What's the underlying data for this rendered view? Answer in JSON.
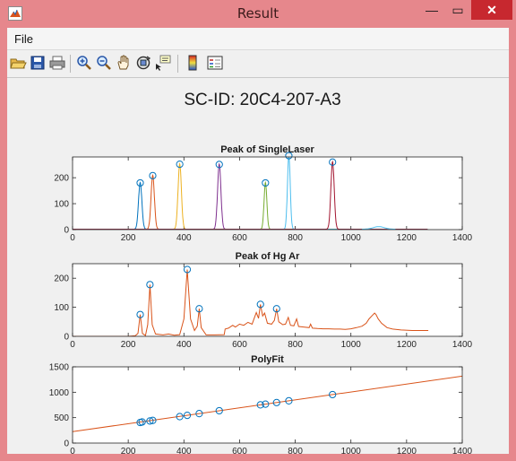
{
  "window": {
    "title": "Result",
    "min_glyph": "—",
    "max_glyph": "▭",
    "close_glyph": "✕"
  },
  "menu": {
    "file_label": "File"
  },
  "toolbar": {
    "tools": [
      {
        "name": "open-icon"
      },
      {
        "name": "save-icon"
      },
      {
        "name": "print-icon"
      },
      {
        "name": "zoom-in-icon"
      },
      {
        "name": "zoom-out-icon"
      },
      {
        "name": "pan-icon"
      },
      {
        "name": "rotate-3d-icon"
      },
      {
        "name": "data-cursor-icon"
      },
      {
        "name": "colorbar-icon"
      },
      {
        "name": "legend-icon"
      }
    ]
  },
  "figure": {
    "suptitle": "SC-ID: 20C4-207-A3"
  },
  "chart_data": [
    {
      "type": "line",
      "title": "Peak of SingleLaser",
      "xlim": [
        0,
        1400
      ],
      "ylim": [
        0,
        280
      ],
      "xticks": [
        0,
        200,
        400,
        600,
        800,
        1000,
        1200,
        1400
      ],
      "yticks": [
        0,
        100,
        200
      ],
      "series": [
        {
          "color": "#0072bd",
          "center": 243,
          "height": 180,
          "width": 6
        },
        {
          "color": "#d95319",
          "center": 288,
          "height": 208,
          "width": 6
        },
        {
          "color": "#edb120",
          "center": 385,
          "height": 252,
          "width": 6
        },
        {
          "color": "#7e2f8e",
          "center": 527,
          "height": 251,
          "width": 6
        },
        {
          "color": "#77ac30",
          "center": 693,
          "height": 180,
          "width": 5
        },
        {
          "color": "#4dbeee",
          "center": 777,
          "height": 285,
          "width": 5
        },
        {
          "color": "#a2142f",
          "center": 934,
          "height": 260,
          "width": 6
        }
      ],
      "baseline_range": [
        0,
        1275
      ],
      "extra_bump": {
        "color": "#4dbeee",
        "center": 1100,
        "height": 10,
        "width": 20
      },
      "peak_markers": [
        {
          "x": 243,
          "y": 180
        },
        {
          "x": 288,
          "y": 208
        },
        {
          "x": 385,
          "y": 252
        },
        {
          "x": 527,
          "y": 251
        },
        {
          "x": 693,
          "y": 180
        },
        {
          "x": 777,
          "y": 285
        },
        {
          "x": 934,
          "y": 260
        }
      ]
    },
    {
      "type": "line",
      "title": "Peak of Hg Ar",
      "xlim": [
        0,
        1400
      ],
      "ylim": [
        0,
        250
      ],
      "xticks": [
        0,
        200,
        400,
        600,
        800,
        1000,
        1200,
        1400
      ],
      "yticks": [
        0,
        100,
        200
      ],
      "color": "#d95319",
      "line": [
        [
          0,
          0
        ],
        [
          200,
          0
        ],
        [
          225,
          2
        ],
        [
          235,
          10
        ],
        [
          243,
          75
        ],
        [
          251,
          10
        ],
        [
          262,
          3
        ],
        [
          270,
          40
        ],
        [
          278,
          178
        ],
        [
          286,
          40
        ],
        [
          298,
          8
        ],
        [
          325,
          5
        ],
        [
          345,
          8
        ],
        [
          365,
          4
        ],
        [
          385,
          6
        ],
        [
          400,
          60
        ],
        [
          412,
          230
        ],
        [
          424,
          60
        ],
        [
          438,
          20
        ],
        [
          448,
          35
        ],
        [
          455,
          95
        ],
        [
          462,
          30
        ],
        [
          480,
          5
        ],
        [
          510,
          5
        ],
        [
          545,
          6
        ],
        [
          548,
          25
        ],
        [
          560,
          28
        ],
        [
          575,
          38
        ],
        [
          585,
          32
        ],
        [
          600,
          42
        ],
        [
          615,
          38
        ],
        [
          630,
          48
        ],
        [
          645,
          42
        ],
        [
          660,
          82
        ],
        [
          668,
          62
        ],
        [
          675,
          110
        ],
        [
          683,
          70
        ],
        [
          690,
          80
        ],
        [
          700,
          45
        ],
        [
          715,
          42
        ],
        [
          725,
          55
        ],
        [
          733,
          95
        ],
        [
          741,
          50
        ],
        [
          755,
          40
        ],
        [
          765,
          42
        ],
        [
          775,
          65
        ],
        [
          783,
          38
        ],
        [
          795,
          36
        ],
        [
          805,
          60
        ],
        [
          812,
          34
        ],
        [
          830,
          32
        ],
        [
          850,
          30
        ],
        [
          855,
          42
        ],
        [
          862,
          28
        ],
        [
          880,
          27
        ],
        [
          900,
          26
        ],
        [
          920,
          26
        ],
        [
          940,
          25
        ],
        [
          960,
          25
        ],
        [
          980,
          24
        ],
        [
          1000,
          26
        ],
        [
          1020,
          30
        ],
        [
          1040,
          35
        ],
        [
          1055,
          45
        ],
        [
          1065,
          60
        ],
        [
          1075,
          70
        ],
        [
          1085,
          80
        ],
        [
          1090,
          75
        ],
        [
          1098,
          60
        ],
        [
          1110,
          45
        ],
        [
          1130,
          30
        ],
        [
          1150,
          25
        ],
        [
          1180,
          22
        ],
        [
          1220,
          20
        ],
        [
          1250,
          20
        ],
        [
          1278,
          20
        ]
      ],
      "peak_markers": [
        {
          "x": 243,
          "y": 75
        },
        {
          "x": 278,
          "y": 178
        },
        {
          "x": 412,
          "y": 230
        },
        {
          "x": 455,
          "y": 95
        },
        {
          "x": 675,
          "y": 110
        },
        {
          "x": 733,
          "y": 95
        }
      ]
    },
    {
      "type": "scatter",
      "title": "PolyFit",
      "xlim": [
        0,
        1400
      ],
      "ylim": [
        0,
        1500
      ],
      "xticks": [
        0,
        200,
        400,
        600,
        800,
        1000,
        1200,
        1400
      ],
      "yticks": [
        0,
        500,
        1000,
        1500
      ],
      "fit_line": {
        "color": "#d95319",
        "slope": 0.78,
        "intercept": 225
      },
      "points": [
        {
          "x": 243,
          "y": 405
        },
        {
          "x": 250,
          "y": 415
        },
        {
          "x": 278,
          "y": 435
        },
        {
          "x": 288,
          "y": 445
        },
        {
          "x": 385,
          "y": 520
        },
        {
          "x": 412,
          "y": 545
        },
        {
          "x": 455,
          "y": 580
        },
        {
          "x": 527,
          "y": 636
        },
        {
          "x": 675,
          "y": 752
        },
        {
          "x": 693,
          "y": 766
        },
        {
          "x": 733,
          "y": 797
        },
        {
          "x": 777,
          "y": 831
        },
        {
          "x": 934,
          "y": 954
        }
      ]
    }
  ]
}
